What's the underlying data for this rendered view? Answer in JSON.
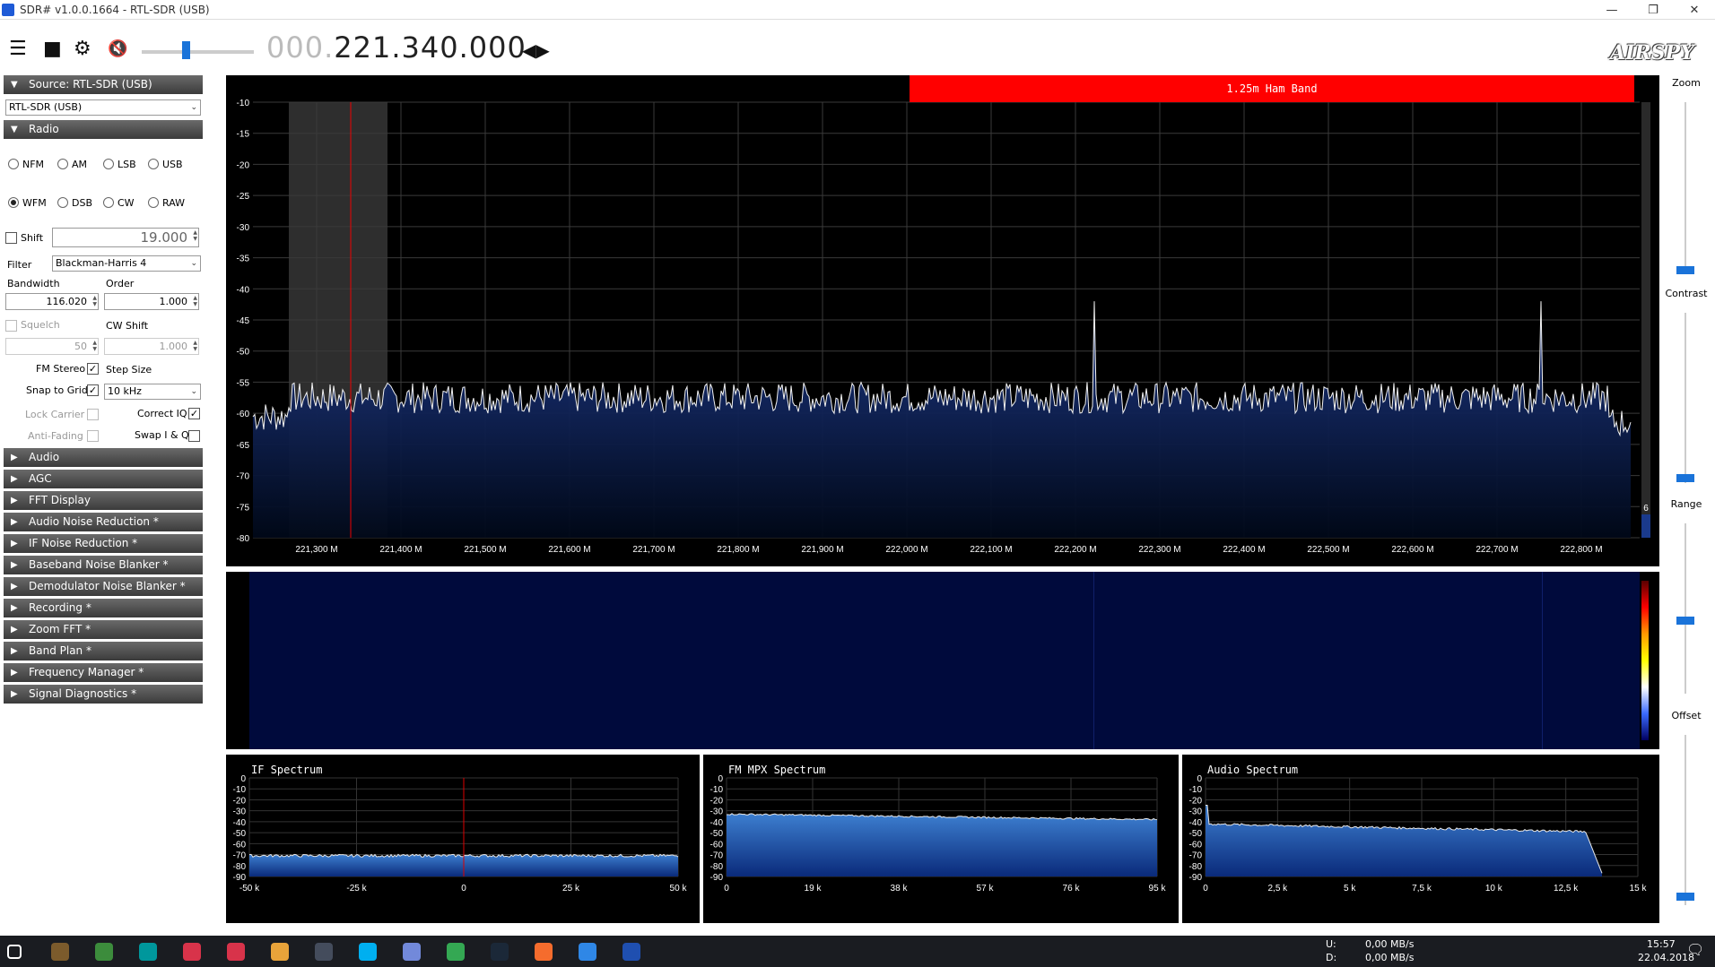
{
  "window": {
    "title": "SDR# v1.0.0.1664 - RTL-SDR (USB)",
    "controls": [
      "—",
      "❐",
      "✕"
    ]
  },
  "toolbar": {
    "freq_dim": "000.",
    "freq_main": "221.340.000",
    "logo": "AIRSPY",
    "icons": [
      "menu-icon",
      "stop-icon",
      "gear-icon",
      "mute-icon"
    ]
  },
  "sidebar": {
    "source_header": "Source: RTL-SDR (USB)",
    "source_value": "RTL-SDR (USB)",
    "radio_header": "Radio",
    "modes_row1": [
      "NFM",
      "AM",
      "LSB",
      "USB"
    ],
    "modes_row2": [
      "WFM",
      "DSB",
      "CW",
      "RAW"
    ],
    "selected_mode": "WFM",
    "shift_label": "Shift",
    "shift_value": "19.000",
    "filter_label": "Filter",
    "filter_value": "Blackman-Harris 4",
    "bandwidth_label": "Bandwidth",
    "bandwidth_value": "116.020",
    "order_label": "Order",
    "order_value": "1.000",
    "squelch_label": "Squelch",
    "squelch_value": "50",
    "cwshift_label": "CW Shift",
    "cwshift_value": "1.000",
    "fmstereo_label": "FM Stereo",
    "stepsize_label": "Step Size",
    "snap_label": "Snap to Grid",
    "step_value": "10 kHz",
    "lockcarrier_label": "Lock Carrier",
    "correctiq_label": "Correct IQ",
    "antifading_label": "Anti-Fading",
    "swapiq_label": "Swap I & Q",
    "sections": [
      "Audio",
      "AGC",
      "FFT Display",
      "Audio Noise Reduction *",
      "IF Noise Reduction *",
      "Baseband Noise Blanker *",
      "Demodulator Noise Blanker *",
      "Recording *",
      "Zoom FFT *",
      "Band Plan *",
      "Frequency Manager *",
      "Signal Diagnostics *"
    ]
  },
  "main_spectrum": {
    "band_label": "1.25m Ham Band",
    "y_ticks": [
      "-10",
      "-15",
      "-20",
      "-25",
      "-30",
      "-35",
      "-40",
      "-45",
      "-50",
      "-55",
      "-60",
      "-65",
      "-70",
      "-75",
      "-80"
    ],
    "x_ticks": [
      "221,300 M",
      "221,400 M",
      "221,500 M",
      "221,600 M",
      "221,700 M",
      "221,800 M",
      "221,900 M",
      "222,000 M",
      "222,100 M",
      "222,200 M",
      "222,300 M",
      "222,400 M",
      "222,500 M",
      "222,600 M",
      "222,700 M",
      "222,800 M"
    ],
    "side_value": "6"
  },
  "right_controls": {
    "labels": [
      "Zoom",
      "Contrast",
      "Range",
      "Offset"
    ]
  },
  "if_spectrum": {
    "title": "IF Spectrum",
    "y_ticks": [
      "0",
      "-10",
      "-20",
      "-30",
      "-40",
      "-50",
      "-60",
      "-70",
      "-80",
      "-90"
    ],
    "x_ticks": [
      "-50 k",
      "-25 k",
      "0",
      "25 k",
      "50 k"
    ]
  },
  "mpx_spectrum": {
    "title": "FM MPX Spectrum",
    "y_ticks": [
      "0",
      "-10",
      "-20",
      "-30",
      "-40",
      "-50",
      "-60",
      "-70",
      "-80",
      "-90"
    ],
    "x_ticks": [
      "0",
      "19 k",
      "38 k",
      "57 k",
      "76 k",
      "95 k"
    ]
  },
  "audio_spectrum": {
    "title": "Audio Spectrum",
    "y_ticks": [
      "0",
      "-10",
      "-20",
      "-30",
      "-40",
      "-50",
      "-60",
      "-70",
      "-80",
      "-90"
    ],
    "x_ticks": [
      "0",
      "2,5 k",
      "5 k",
      "7,5 k",
      "10 k",
      "12,5 k",
      "15 k"
    ]
  },
  "taskbar": {
    "upload_label": "U:",
    "download_label": "D:",
    "upload_rate": "0,00 MB/s",
    "download_rate": "0,00 MB/s",
    "time": "15:57",
    "date": "22.04.2018",
    "app_icons": [
      "windows-start-icon",
      "minecraft-icon",
      "xbox-icon",
      "arduino-icon",
      "app-red-icon",
      "app-pink-icon",
      "app-yellow-icon",
      "app-dark-icon",
      "skype-icon",
      "discord-icon",
      "chrome-icon",
      "steam-icon",
      "origin-icon",
      "plane-icon",
      "sdr-icon"
    ]
  }
}
